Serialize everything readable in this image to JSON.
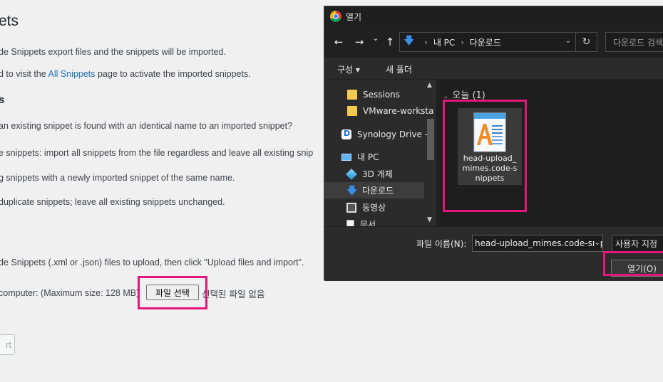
{
  "wp": {
    "title": "ets",
    "line1": "de Snippets export files and the snippets will be imported.",
    "line2_pre": "d to visit the ",
    "line2_link": "All Snippets",
    "line2_post": " page to activate the imported snippets.",
    "heading": "s",
    "q": "an existing snippet is found with an identical name to an imported snippet?",
    "opt1": "e snippets: import all snippets from the file regardless and leave all existing snip",
    "opt2": "g snippets with a newly imported snippet of the same name.",
    "opt3": "duplicate snippets; leave all existing snippets unchanged.",
    "upload_desc": "de Snippets (.xml or .json) files to upload, then click \"Upload files and import\".",
    "computer_label": "computer: (Maximum size: 128 MB)",
    "file_button": "파일 선택",
    "no_file": "선택된 파일 없음",
    "upload_button": "rt"
  },
  "dialog": {
    "title": "열기",
    "nav": {
      "back": "←",
      "forward": "→",
      "recent": "⌄",
      "up": "↑"
    },
    "breadcrumb": [
      "내 PC",
      "다운로드"
    ],
    "refresh": "↻",
    "search_placeholder": "다운로드 검색",
    "toolbar": {
      "organize": "구성 ▾",
      "new_folder": "새 폴더"
    },
    "sidebar": [
      {
        "label": "Sessions",
        "icon": "folder-icon"
      },
      {
        "label": "VMware-worksta",
        "icon": "folder-icon"
      },
      {
        "label": "Synology Drive -",
        "icon": "synology-drive-icon"
      },
      {
        "label": "내 PC",
        "icon": "pc-icon"
      },
      {
        "label": "3D 개체",
        "icon": "3d-objects-icon"
      },
      {
        "label": "다운로드",
        "icon": "downloads-icon",
        "selected": true
      },
      {
        "label": "동영상",
        "icon": "videos-icon"
      },
      {
        "label": "문서",
        "icon": "documents-icon"
      }
    ],
    "group_header": "오늘 (1)",
    "file": {
      "name": "head-upload_mimes.code-snippets",
      "icon": "wordpad-document-icon"
    },
    "filename_label": "파일 이름(N):",
    "filename_value": "head-upload_mimes.code-snippets",
    "filetype": "사용자 지정",
    "open_button": "열기(O)"
  },
  "colors": {
    "highlight": "#e6157a",
    "wp_link": "#2271b1",
    "dialog_bg": "#202020"
  }
}
